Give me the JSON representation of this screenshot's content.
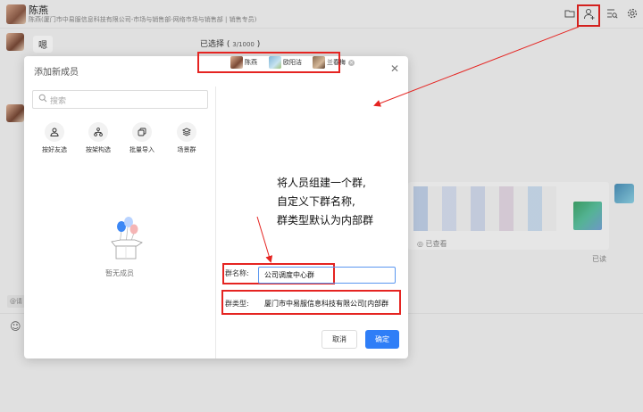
{
  "chat": {
    "name": "陈燕",
    "subtitle": "陈燕(厦门市中易服信息科技有限公司-市场与销售部-网络市场与销售部 | 销售专员)",
    "message": "嗯",
    "seen_label": "已查看",
    "read_label": "已读",
    "mention_chip": "@请"
  },
  "header_icons": [
    "folder-icon",
    "add-member-icon",
    "search-list-icon",
    "settings-icon"
  ],
  "dialog": {
    "title": "添加新成员",
    "search_placeholder": "搜索",
    "tools": [
      {
        "label": "按好友选",
        "icon": "person-icon"
      },
      {
        "label": "按架构选",
        "icon": "org-icon"
      },
      {
        "label": "批量导入",
        "icon": "copy-icon"
      },
      {
        "label": "场景群",
        "icon": "layers-icon"
      }
    ],
    "empty_text": "暂无成员",
    "selected_label": "已选择",
    "selected_count": "3/1000",
    "selected": [
      "陈燕",
      "欧阳洁",
      "兰春梅"
    ],
    "group_name_label": "群名称:",
    "group_name_value": "公司调度中心群",
    "group_type_label": "群类型:",
    "group_type_value": "厦门市中易服信息科技有限公司[内部群",
    "cancel_label": "取消",
    "ok_label": "确定"
  },
  "annotation": {
    "line1": "将人员组建一个群,",
    "line2": "自定义下群名称,",
    "line3": "群类型默认为内部群"
  },
  "colors": {
    "highlight": "#e52421",
    "primary": "#2f7ef7"
  }
}
